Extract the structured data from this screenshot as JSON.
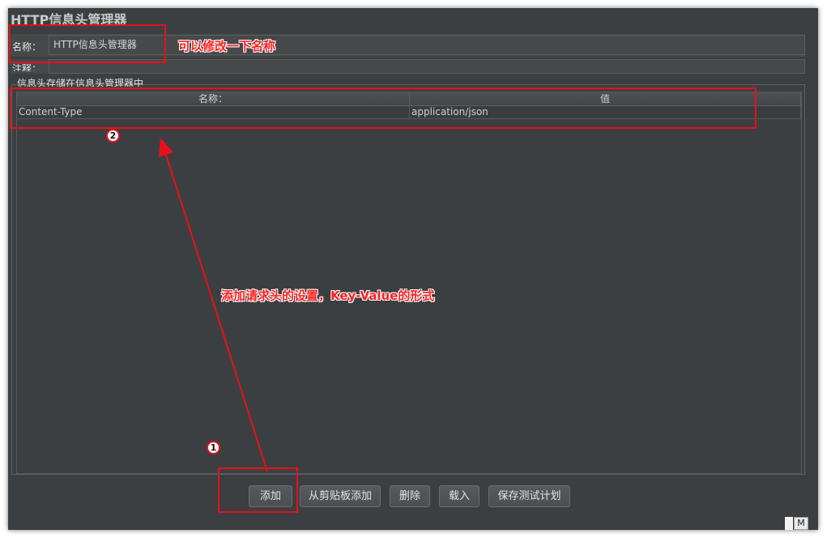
{
  "panel": {
    "title": "HTTP信息头管理器",
    "name_label": "名称：",
    "name_value": "HTTP信息头管理器",
    "comment_label": "注释：",
    "group_label": "信息头存储在信息头管理器中"
  },
  "table": {
    "columns": [
      "名称：",
      "值"
    ],
    "rows": [
      {
        "name": "Content-Type",
        "value": "application/json"
      }
    ]
  },
  "buttons": {
    "add": "添加",
    "add_from_clipboard": "从剪贴板添加",
    "delete": "删除",
    "load": "载入",
    "save_test_plan": "保存测试计划"
  },
  "annotations": {
    "rename_hint": "可以修改一下名称",
    "add_header_hint": "添加请求头的设置，Key-Value的形式",
    "badge_one": "1",
    "badge_two": "2",
    "color": "#e8101a"
  },
  "corner_icon": "M"
}
